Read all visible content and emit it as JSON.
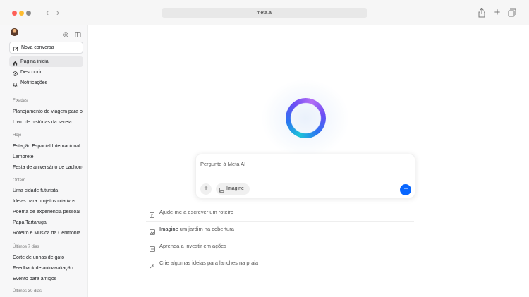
{
  "browser": {
    "url": "meta.ai",
    "icons": [
      "chevron-left-icon",
      "chevron-right-icon",
      "share-icon",
      "plus-icon",
      "tabs-icon"
    ]
  },
  "sidebar": {
    "new_chat": "Nova conversa",
    "nav": [
      {
        "label": "Página inicial",
        "icon": "home-icon"
      },
      {
        "label": "Descobrir",
        "icon": "compass-icon"
      },
      {
        "label": "Notificações",
        "icon": "bell-icon"
      }
    ],
    "sections": {
      "pinned": {
        "title": "Fixadas",
        "items": [
          "Planejamento de viagem para o...",
          "Livro de histórias da sereia"
        ]
      },
      "today": {
        "title": "Hoje",
        "items": [
          "Estação Espacial Internacional",
          "Lembrete",
          "Festa de aniversário de cachorro"
        ]
      },
      "yesterday": {
        "title": "Ontem",
        "items": [
          "Uma cidade futurista",
          "Ideias para projetos criativos",
          "Poema de experiência pessoal",
          "Papa Tartaruga",
          "Roteiro e Música da Cerimônia"
        ]
      },
      "last7": {
        "title": "Últimos 7 dias",
        "items": [
          "Corte de unhas de gato",
          "Feedback de autoavaliação",
          "Evento para amigos"
        ]
      },
      "last30": {
        "title": "Últimos 30 dias"
      }
    }
  },
  "prompt": {
    "placeholder": "Pergunte à Meta AI",
    "imagine_label": "Imagine"
  },
  "suggestions": [
    {
      "bold": "",
      "text": "Ajude-me a escrever um roteiro",
      "icon": "pencil-icon"
    },
    {
      "bold": "Imagine",
      "text": " um jardim na cobertura",
      "icon": "image-icon"
    },
    {
      "bold": "",
      "text": "Aprenda a investir em ações",
      "icon": "book-icon"
    },
    {
      "bold": "",
      "text": "Crie algumas ideias para lanches na praia",
      "icon": "sparkle-icon"
    }
  ],
  "colors": {
    "accent": "#0866ff",
    "sidebar_bg": "#f7f7f8"
  }
}
